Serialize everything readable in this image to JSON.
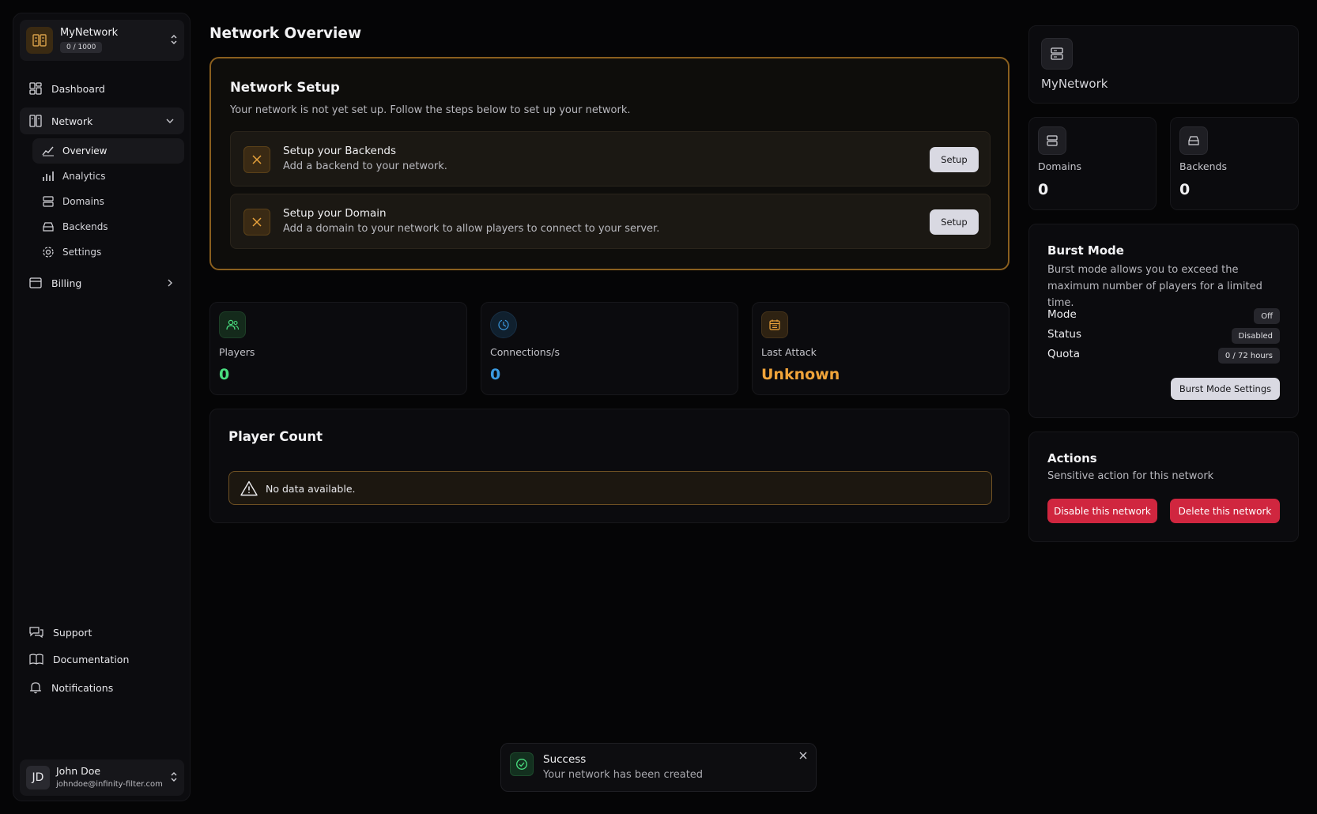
{
  "team": {
    "name": "MyNetwork",
    "usage": "0 / 1000"
  },
  "nav": {
    "dashboard": "Dashboard",
    "network": "Network",
    "overview": "Overview",
    "analytics": "Analytics",
    "domains": "Domains",
    "backends": "Backends",
    "settings": "Settings",
    "billing": "Billing",
    "support": "Support",
    "documentation": "Documentation",
    "notifications": "Notifications"
  },
  "user": {
    "name": "John Doe",
    "email": "johndoe@infinity-filter.com",
    "initials": "JD"
  },
  "page": {
    "title": "Network Overview"
  },
  "setup": {
    "title": "Network Setup",
    "subtitle": "Your network is not yet set up. Follow the steps below to set up your network.",
    "steps": [
      {
        "title": "Setup your Backends",
        "desc": "Add a backend to your network.",
        "button": "Setup"
      },
      {
        "title": "Setup your Domain",
        "desc": "Add a domain to your network to allow players to connect to your server.",
        "button": "Setup"
      }
    ]
  },
  "stats": [
    {
      "label": "Players",
      "value": "0",
      "color": "#4ade80"
    },
    {
      "label": "Connections/s",
      "value": "0",
      "color": "#3b9ae1"
    },
    {
      "label": "Last Attack",
      "value": "Unknown",
      "color": "#f0a43a"
    }
  ],
  "player_count": {
    "title": "Player Count",
    "empty": "No data available."
  },
  "network_card": {
    "name": "MyNetwork"
  },
  "domains_card": {
    "label": "Domains",
    "value": "0"
  },
  "backends_card": {
    "label": "Backends",
    "value": "0"
  },
  "burst": {
    "title": "Burst Mode",
    "desc": "Burst mode allows you to exceed the maximum number of players for a limited time.",
    "rows": [
      {
        "label": "Mode",
        "value": "Off"
      },
      {
        "label": "Status",
        "value": "Disabled"
      },
      {
        "label": "Quota",
        "value": "0 / 72 hours"
      }
    ],
    "button": "Burst Mode Settings"
  },
  "actions": {
    "title": "Actions",
    "desc": "Sensitive action for this network",
    "disable": "Disable this network",
    "delete": "Delete this network"
  },
  "toast": {
    "title": "Success",
    "message": "Your network has been created"
  },
  "colors": {
    "accent": "#d7a04a",
    "danger": "#d0263f",
    "success": "#4ade80"
  }
}
